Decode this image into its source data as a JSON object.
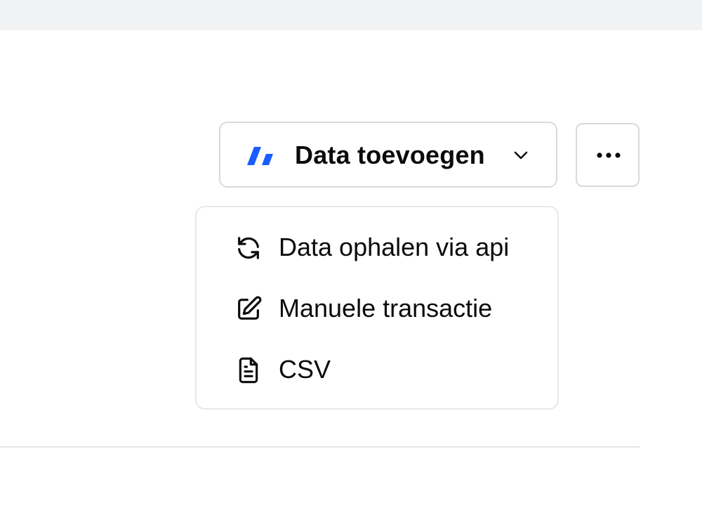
{
  "toolbar": {
    "add_data_label": "Data toevoegen",
    "brand_icon": "brand-logo-icon",
    "chevron_icon": "chevron-down-icon",
    "more_icon": "more-horizontal-icon"
  },
  "dropdown": {
    "items": [
      {
        "label": "Data ophalen via api",
        "icon": "refresh-icon"
      },
      {
        "label": "Manuele transactie",
        "icon": "edit-icon"
      },
      {
        "label": "CSV",
        "icon": "file-icon"
      }
    ]
  },
  "colors": {
    "accent": "#1a5cff",
    "border": "#d7dade",
    "text": "#0b0b0d",
    "background": "#f1f2f4"
  }
}
